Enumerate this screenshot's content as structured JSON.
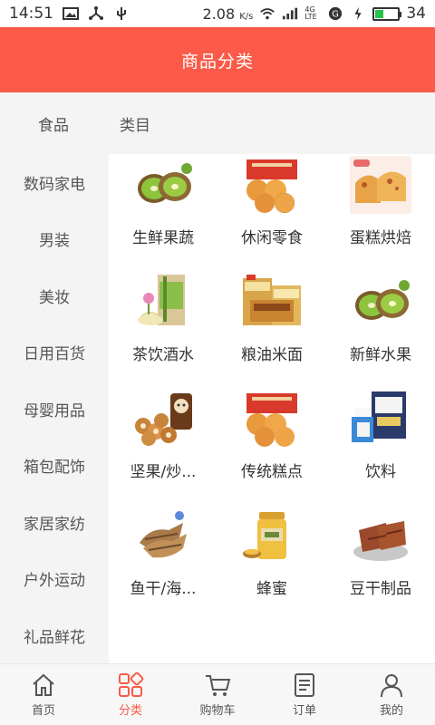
{
  "status_bar": {
    "time": "14:51",
    "speed": "2.08",
    "speed_unit": "K/s",
    "network": "4G LTE",
    "battery": "34",
    "battery_level": 0.34
  },
  "header": {
    "title": "商品分类"
  },
  "sub_tabs": [
    "食品",
    "类目"
  ],
  "sidebar": {
    "items": [
      "数码家电",
      "男装",
      "美妆",
      "日用百货",
      "母婴用品",
      "箱包配饰",
      "家居家纺",
      "户外运动",
      "礼品鲜花"
    ]
  },
  "grid": {
    "items": [
      {
        "label": "生鲜果蔬",
        "icon": "kiwi-fruit-image"
      },
      {
        "label": "休闲零食",
        "icon": "snack-cakes-image"
      },
      {
        "label": "蛋糕烘焙",
        "icon": "bread-cake-image"
      },
      {
        "label": "茶饮酒水",
        "icon": "tea-package-image"
      },
      {
        "label": "粮油米面",
        "icon": "grain-snack-box-image"
      },
      {
        "label": "新鲜水果",
        "icon": "kiwi-fruit-image"
      },
      {
        "label": "坚果/炒...",
        "icon": "nuts-package-image"
      },
      {
        "label": "传统糕点",
        "icon": "traditional-pastry-image"
      },
      {
        "label": "饮料",
        "icon": "coconut-milk-drink-image"
      },
      {
        "label": "鱼干/海...",
        "icon": "dried-fish-image"
      },
      {
        "label": "蜂蜜",
        "icon": "honey-jar-image"
      },
      {
        "label": "豆干制品",
        "icon": "dried-tofu-image"
      }
    ]
  },
  "bottom_nav": {
    "items": [
      {
        "label": "首页",
        "icon": "home-icon"
      },
      {
        "label": "分类",
        "icon": "category-icon"
      },
      {
        "label": "购物车",
        "icon": "cart-icon"
      },
      {
        "label": "订单",
        "icon": "order-icon"
      },
      {
        "label": "我的",
        "icon": "profile-icon"
      }
    ],
    "active_index": 1
  },
  "colors": {
    "accent": "#fa5a47",
    "sidebar_bg": "#f4f4f4",
    "battery_green": "#27c24c"
  }
}
